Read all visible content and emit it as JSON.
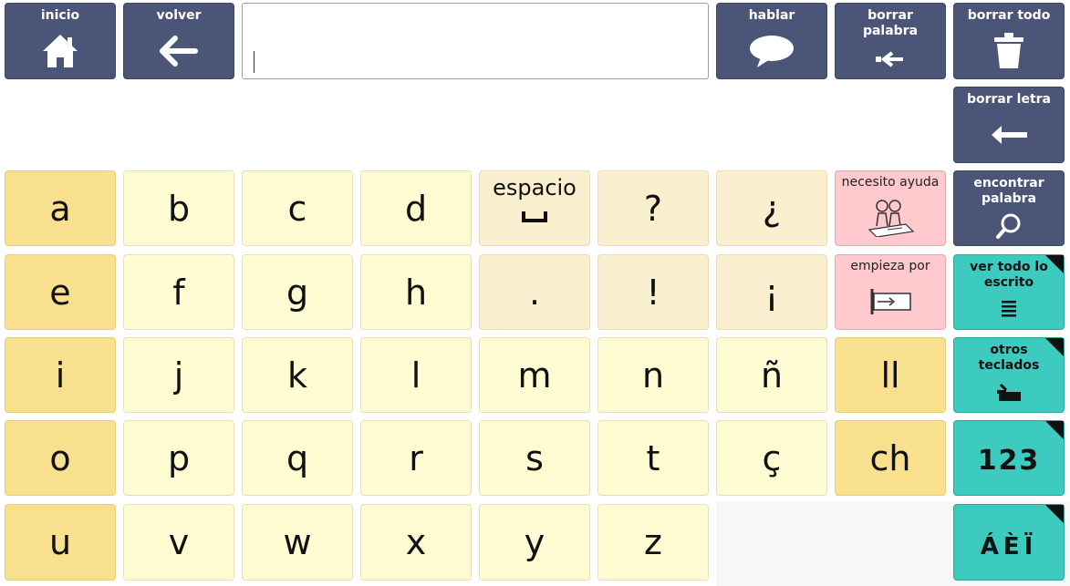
{
  "top": {
    "home": {
      "label": "inicio",
      "icon": "home-icon"
    },
    "back": {
      "label": "volver",
      "icon": "arrow-left-icon"
    },
    "message_value": "",
    "speak": {
      "label": "hablar",
      "icon": "speech-bubble-icon"
    },
    "delete_word": {
      "label": "borrar\npalabra",
      "icon": "delete-word-icon"
    },
    "delete_all": {
      "label": "borrar todo",
      "icon": "trash-icon"
    },
    "delete_letter": {
      "label": "borrar letra",
      "icon": "backspace-arrow-icon"
    }
  },
  "side": {
    "find_word": {
      "label": "encontrar\npalabra",
      "icon": "magnifier-icon"
    },
    "see_all": {
      "label": "ver todo lo\nescrito",
      "icon": "text-lines-icon"
    },
    "other_keyboards": {
      "label": "otros\nteclados",
      "icon": "keyboard-icon"
    },
    "numbers": {
      "label": "123"
    },
    "accents": {
      "label": "ÁÈÏ"
    }
  },
  "phrases": {
    "help": {
      "label": "necesito ayuda",
      "icon": "people-help-icon"
    },
    "starts_with": {
      "label": "empieza por",
      "icon": "starts-with-icon"
    }
  },
  "keys": {
    "r0": [
      "a",
      "b",
      "c",
      "d",
      "espacio",
      "?",
      "¿"
    ],
    "r1": [
      "e",
      "f",
      "g",
      "h",
      ".",
      "!",
      "¡"
    ],
    "r2": [
      "i",
      "j",
      "k",
      "l",
      "m",
      "n",
      "ñ",
      "ll"
    ],
    "r3": [
      "o",
      "p",
      "q",
      "r",
      "s",
      "t",
      "ç",
      "ch"
    ],
    "r4": [
      "u",
      "v",
      "w",
      "x",
      "y",
      "z"
    ]
  },
  "colors": {
    "nav": "#4a5578",
    "teal": "#3ecbbf",
    "key_light": "#fffbd2",
    "key_dark": "#f8e08f",
    "pink": "#ffc9cd"
  }
}
